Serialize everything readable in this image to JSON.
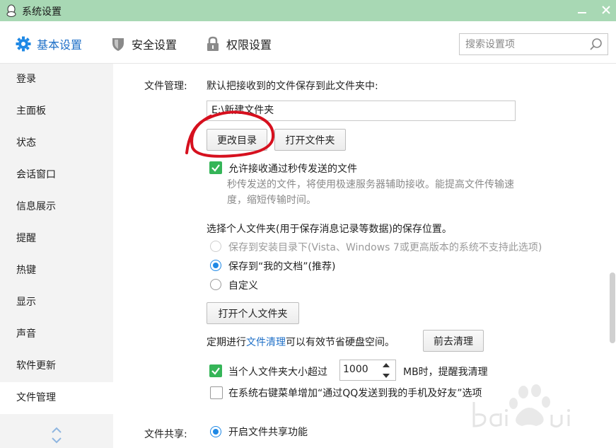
{
  "window": {
    "title": "系统设置"
  },
  "tabs": [
    {
      "label": "基本设置",
      "icon": "gear-icon",
      "active": true
    },
    {
      "label": "安全设置",
      "icon": "shield-icon",
      "active": false
    },
    {
      "label": "权限设置",
      "icon": "lock-icon",
      "active": false
    }
  ],
  "search": {
    "placeholder": "搜索设置项",
    "value": ""
  },
  "sidebar": {
    "items": [
      {
        "label": "登录"
      },
      {
        "label": "主面板"
      },
      {
        "label": "状态"
      },
      {
        "label": "会话窗口"
      },
      {
        "label": "信息展示"
      },
      {
        "label": "提醒"
      },
      {
        "label": "热键"
      },
      {
        "label": "显示"
      },
      {
        "label": "声音"
      },
      {
        "label": "软件更新"
      },
      {
        "label": "文件管理",
        "active": true
      }
    ]
  },
  "file_management": {
    "section_label": "文件管理:",
    "default_save_text": "默认把接收到的文件保存到此文件夹中:",
    "path_value": "E:\\新建文件夹",
    "change_dir_button": "更改目录",
    "open_folder_button": "打开文件夹",
    "allow_instant_transfer": {
      "label": "允许接收通过秒传发送的文件",
      "checked": true
    },
    "instant_hint_line1": "秒传发送的文件，将使用极速服务器辅助接收。能提高文件传输速",
    "instant_hint_line2": "度，缩短传输时间。",
    "personal_folder_prompt": "选择个人文件夹(用于保存消息记录等数据)的保存位置。",
    "radio_options": [
      {
        "label": "保存到安装目录下(Vista、Windows 7或更高版本的系统不支持此选项)",
        "state": "disabled"
      },
      {
        "label": "保存到“我的文档”(推荐)",
        "state": "checked"
      },
      {
        "label": "自定义",
        "state": "unchecked"
      }
    ],
    "open_personal_folder_button": "打开个人文件夹",
    "cleanup_prefix": "定期进行",
    "cleanup_link": "文件清理",
    "cleanup_suffix": "可以有效节省硬盘空间。",
    "cleanup_button": "前去清理",
    "size_warning": {
      "prefix": "当个人文件夹大小超过",
      "value": "1000",
      "suffix": "MB时，提醒我清理",
      "checked": true
    },
    "context_menu": {
      "label": "在系统右键菜单增加“通过QQ发送到我的手机及好友”选项",
      "checked": false
    }
  },
  "file_sharing": {
    "section_label": "文件共享:",
    "enable_label": "开启文件共享功能",
    "enabled": true
  },
  "colors": {
    "titlebar": "#a8d8b4",
    "accent_blue": "#1e6fc7",
    "check_green": "#35b558",
    "annotation_red": "#d6101e"
  }
}
